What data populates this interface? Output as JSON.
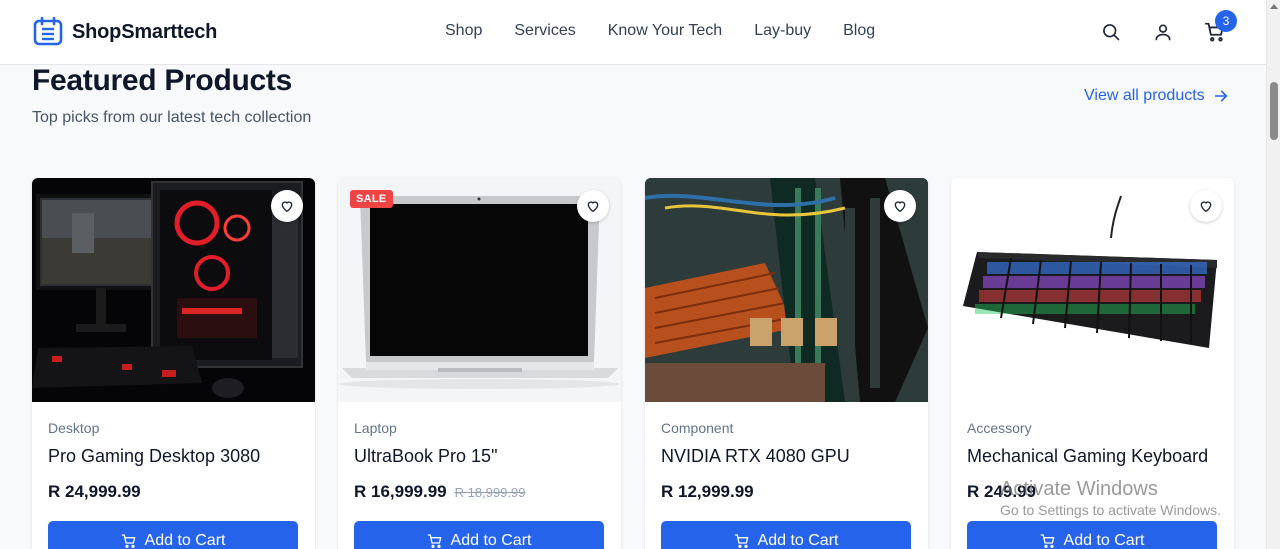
{
  "brand": {
    "name": "ShopSmarttech"
  },
  "nav": [
    "Shop",
    "Services",
    "Know Your Tech",
    "Lay-buy",
    "Blog"
  ],
  "header_icons": {
    "search": "search-icon",
    "account": "user-icon",
    "cart": "cart-icon",
    "cart_count": "3"
  },
  "section": {
    "title": "Featured Products",
    "subtitle": "Top picks from our latest tech collection",
    "view_all": "View all products"
  },
  "products": [
    {
      "category": "Desktop",
      "name": "Pro Gaming Desktop 3080",
      "price": "R 24,999.99",
      "old_price": "",
      "badge": "",
      "button": "Add to Cart"
    },
    {
      "category": "Laptop",
      "name": "UltraBook Pro 15\"",
      "price": "R 16,999.99",
      "old_price": "R 18,999.99",
      "badge": "SALE",
      "button": "Add to Cart"
    },
    {
      "category": "Component",
      "name": "NVIDIA RTX 4080 GPU",
      "price": "R 12,999.99",
      "old_price": "",
      "badge": "",
      "button": "Add to Cart"
    },
    {
      "category": "Accessory",
      "name": "Mechanical Gaming Keyboard",
      "price": "R 249.99",
      "old_price": "",
      "badge": "",
      "button": "Add to Cart"
    }
  ],
  "watermark": {
    "line1": "Activate Windows",
    "line2": "Go to Settings to activate Windows."
  },
  "colors": {
    "accent": "#2563eb",
    "sale": "#ef4444",
    "text": "#0f172a",
    "muted": "#64748b"
  }
}
